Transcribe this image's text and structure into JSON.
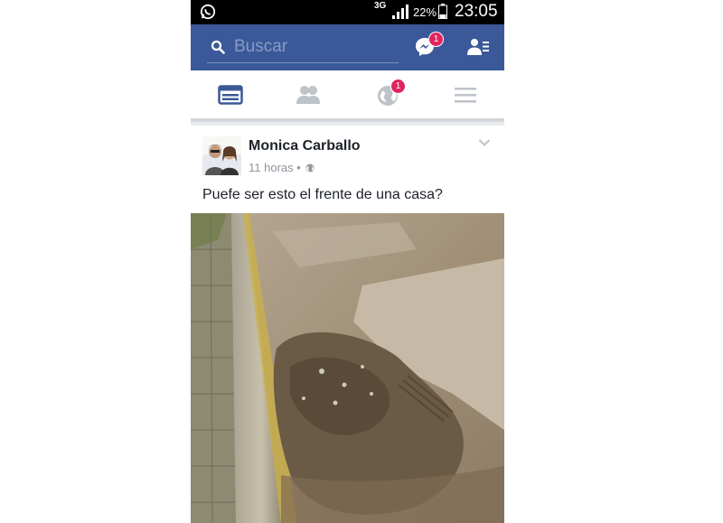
{
  "status_bar": {
    "network": "3G",
    "battery_percent": "22%",
    "time": "23:05"
  },
  "top_bar": {
    "search_placeholder": "Buscar",
    "messenger_badge": "1"
  },
  "tabs": [
    {
      "name": "news-feed",
      "active": true
    },
    {
      "name": "friends",
      "active": false
    },
    {
      "name": "notifications",
      "active": false,
      "badge": "1"
    },
    {
      "name": "menu",
      "active": false
    }
  ],
  "post": {
    "author": "Monica Carballo",
    "time": "11 horas",
    "separator": "•",
    "text": "Puefe ser esto el frente de una casa?",
    "photo_alt": "street curb with mud and debris"
  },
  "colors": {
    "brand": "#3b5998",
    "badge": "#e0245e",
    "tab_active": "#3b5998",
    "tab_inactive": "#bec3c9"
  }
}
